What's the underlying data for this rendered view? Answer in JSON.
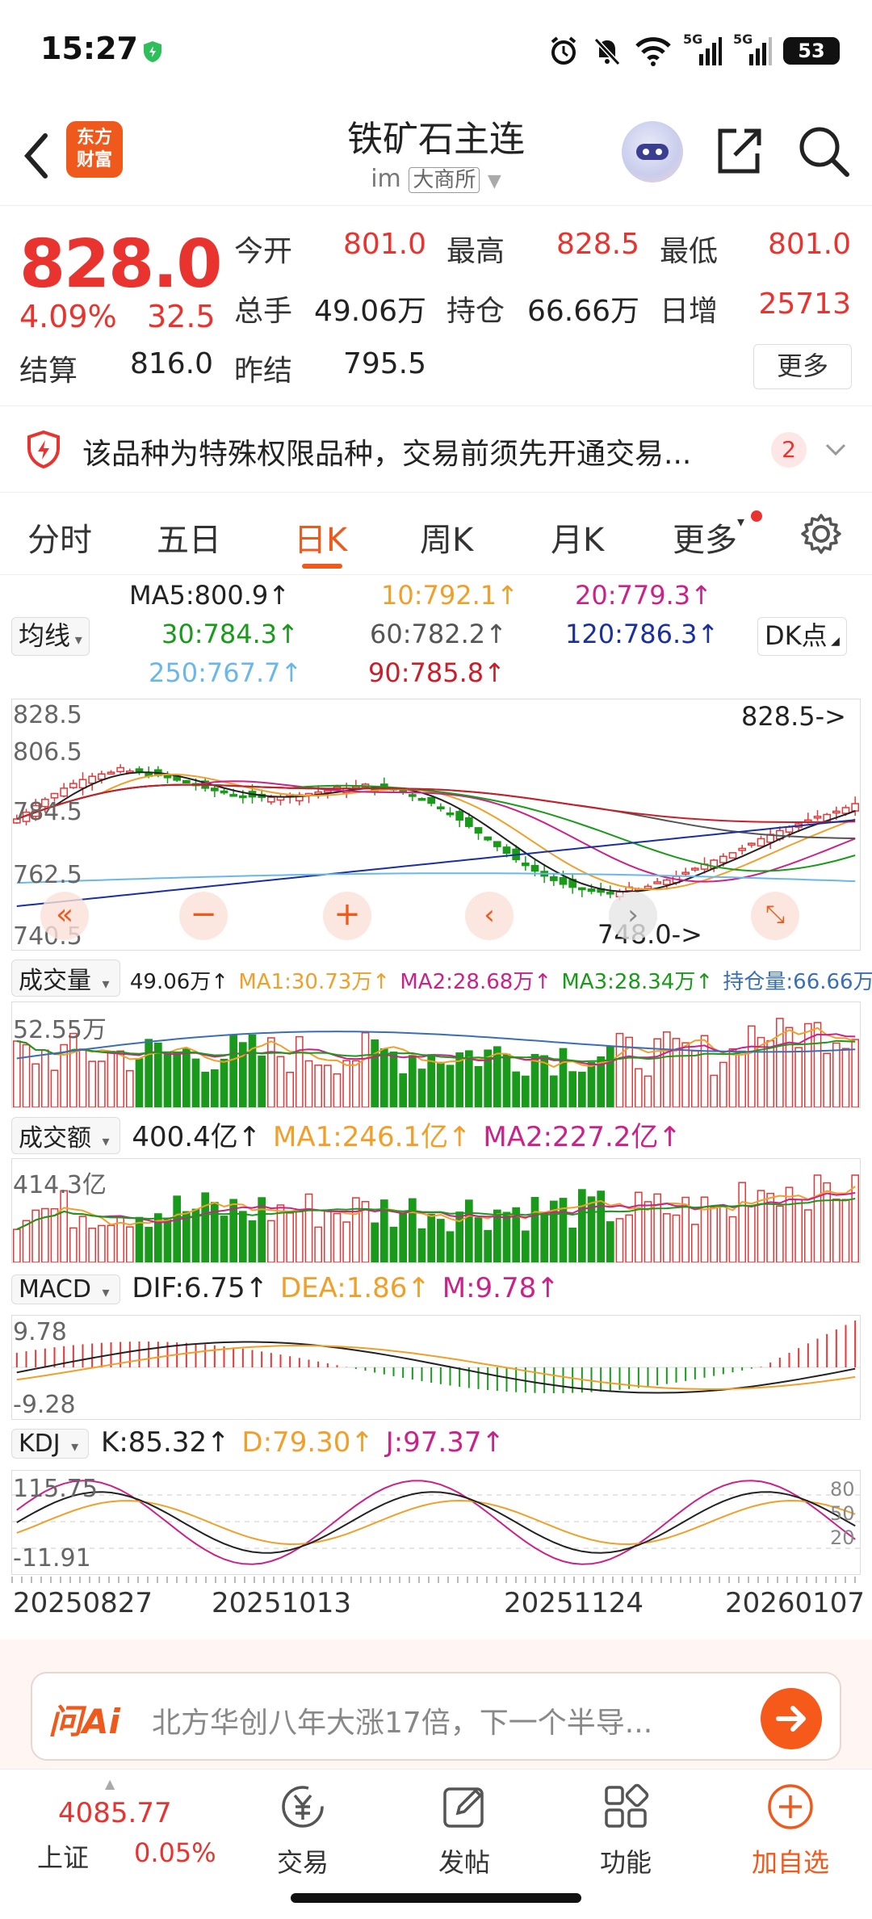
{
  "status": {
    "time": "15:27",
    "battery": "53",
    "net1": "5G",
    "net2": "5G"
  },
  "header": {
    "logo_line1": "东方",
    "logo_line2": "财富",
    "title": "铁矿石主连",
    "subtitle_prefix": "im",
    "exchange": "大商所"
  },
  "quote": {
    "price": "828.0",
    "change_pct": "4.09%",
    "change_abs": "32.5",
    "open_label": "今开",
    "open": "801.0",
    "high_label": "最高",
    "high": "828.5",
    "low_label": "最低",
    "low": "801.0",
    "volume_label": "总手",
    "volume": "49.06万",
    "oi_label": "持仓",
    "oi": "66.66万",
    "daily_inc_label": "日增",
    "daily_inc": "25713",
    "settle_label": "结算",
    "settle": "816.0",
    "prev_settle_label": "昨结",
    "prev_settle": "795.5",
    "more": "更多"
  },
  "notice": {
    "text": "该品种为特殊权限品种，交易前须先开通交易...",
    "badge": "2"
  },
  "tabs": [
    "分时",
    "五日",
    "日K",
    "周K",
    "月K",
    "更多"
  ],
  "ma": {
    "selector": "均线",
    "dk": "DK点",
    "ma5": "MA5:800.9↑",
    "ma10": "10:792.1↑",
    "ma20": "20:779.3↑",
    "ma30": "30:784.3↑",
    "ma60": "60:782.2↑",
    "ma120": "120:786.3↑",
    "ma250": "250:767.7↑",
    "ma90": "90:785.8↑",
    "colors": {
      "ma5": "#222222",
      "ma10": "#f0a02a",
      "ma20": "#c9238a",
      "ma30": "#1a9a1a",
      "ma60": "#555555",
      "ma120": "#1a2fa0",
      "ma250": "#6ab8e8",
      "ma90": "#c8202a"
    }
  },
  "kline": {
    "y_labels": [
      "828.5",
      "806.5",
      "784.5",
      "762.5",
      "740.5"
    ],
    "max_label": "828.5->",
    "min_label": "748.0->"
  },
  "volume": {
    "selector": "成交量",
    "value": "49.06万↑",
    "ma1": "MA1:30.73万↑",
    "ma2": "MA2:28.68万↑",
    "ma3": "MA3:28.34万↑",
    "oi": "持仓量:66.66万↑",
    "axis": "52.55万"
  },
  "turnover": {
    "selector": "成交额",
    "value": "400.4亿↑",
    "ma1": "MA1:246.1亿↑",
    "ma2": "MA2:227.2亿↑",
    "axis": "414.3亿"
  },
  "macd": {
    "selector": "MACD",
    "dif": "DIF:6.75↑",
    "dea": "DEA:1.86↑",
    "m": "M:9.78↑",
    "axis_top": "9.78",
    "axis_bottom": "-9.28"
  },
  "kdj": {
    "selector": "KDJ",
    "k": "K:85.32↑",
    "d": "D:79.30↑",
    "j": "J:97.37↑",
    "axis_top": "115.75",
    "axis_bottom": "-11.91",
    "lvl80": "80",
    "lvl50": "50",
    "lvl20": "20"
  },
  "dates": [
    "20250827",
    "20251013",
    "20251124",
    "20260107"
  ],
  "ask": {
    "logo": "问Ai",
    "placeholder": "北方华创八年大涨17倍，下一个半导..."
  },
  "bottom_nav": {
    "index_value": "4085.77",
    "index_name": "上证",
    "index_change": "0.05%",
    "trade": "交易",
    "post": "发帖",
    "func": "功能",
    "add": "加自选"
  }
}
